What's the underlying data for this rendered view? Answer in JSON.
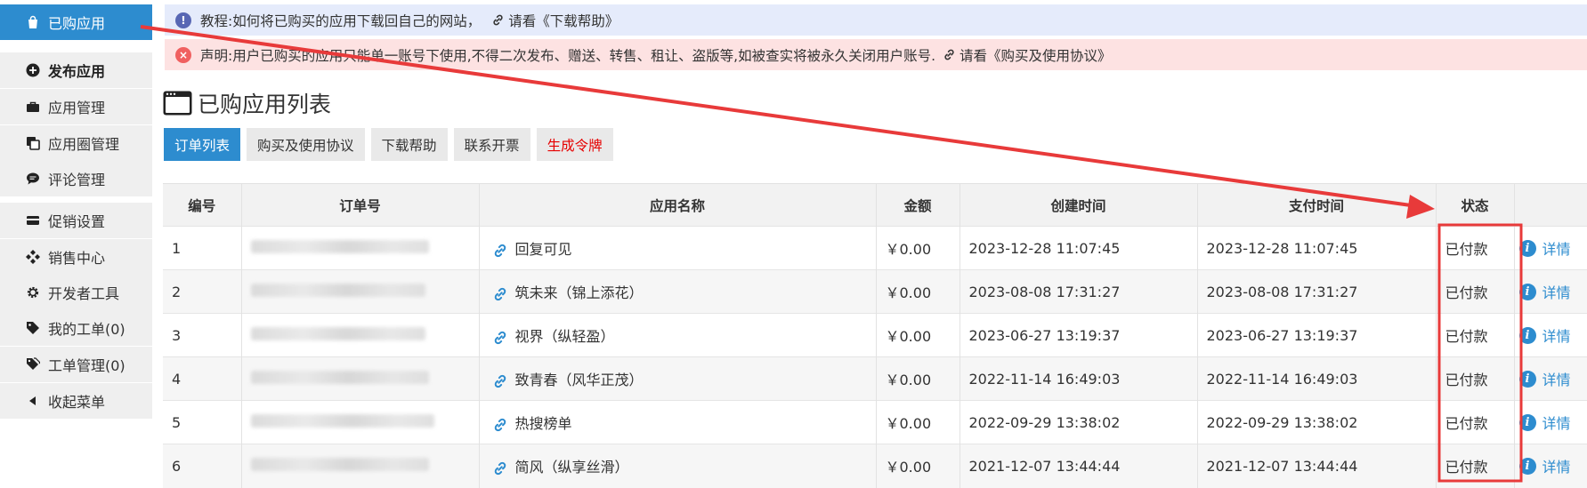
{
  "sidebar": {
    "items": [
      {
        "label": "已购应用",
        "icon": "bag-icon"
      },
      {
        "label": "发布应用",
        "icon": "plus-circle-icon"
      },
      {
        "label": "应用管理",
        "icon": "briefcase-icon"
      },
      {
        "label": "应用圈管理",
        "icon": "copy-icon"
      },
      {
        "label": "评论管理",
        "icon": "comment-icon"
      },
      {
        "label": "促销设置",
        "icon": "card-icon"
      },
      {
        "label": "销售中心",
        "icon": "diamonds-icon"
      },
      {
        "label": "开发者工具",
        "icon": "gear-icon"
      },
      {
        "label": "我的工单(0)",
        "icon": "tag-icon"
      },
      {
        "label": "工单管理(0)",
        "icon": "tags-icon"
      },
      {
        "label": "收起菜单",
        "icon": "caret-left-icon"
      }
    ]
  },
  "alerts": {
    "info": {
      "text": "教程:如何将已购买的应用下载回自己的网站，",
      "link": "请看《下载帮助》"
    },
    "danger": {
      "text": "声明:用户已购买的应用只能单一账号下使用,不得二次发布、赠送、转售、租让、盗版等,如被查实将被永久关闭用户账号.",
      "link": "请看《购买及使用协议》"
    }
  },
  "page": {
    "title": "已购应用列表"
  },
  "tabs": [
    "订单列表",
    "购买及使用协议",
    "下载帮助",
    "联系开票",
    "生成令牌"
  ],
  "table": {
    "headers": [
      "编号",
      "订单号",
      "应用名称",
      "金额",
      "创建时间",
      "支付时间",
      "状态"
    ],
    "rows": [
      {
        "id": "1",
        "app": "回复可见",
        "amount": "￥0.00",
        "created": "2023-12-28 11:07:45",
        "paid": "2023-12-28 11:07:45",
        "status": "已付款",
        "detail": "详情"
      },
      {
        "id": "2",
        "app": "筑未来（锦上添花）",
        "amount": "￥0.00",
        "created": "2023-08-08 17:31:27",
        "paid": "2023-08-08 17:31:27",
        "status": "已付款",
        "detail": "详情"
      },
      {
        "id": "3",
        "app": "视界（纵轻盈）",
        "amount": "￥0.00",
        "created": "2023-06-27 13:19:37",
        "paid": "2023-06-27 13:19:37",
        "status": "已付款",
        "detail": "详情"
      },
      {
        "id": "4",
        "app": "致青春（风华正茂）",
        "amount": "￥0.00",
        "created": "2022-11-14 16:49:03",
        "paid": "2022-11-14 16:49:03",
        "status": "已付款",
        "detail": "详情"
      },
      {
        "id": "5",
        "app": "热搜榜单",
        "amount": "￥0.00",
        "created": "2022-09-29 13:38:02",
        "paid": "2022-09-29 13:38:02",
        "status": "已付款",
        "detail": "详情"
      },
      {
        "id": "6",
        "app": "简风（纵享丝滑）",
        "amount": "￥0.00",
        "created": "2021-12-07 13:44:44",
        "paid": "2021-12-07 13:44:44",
        "status": "已付款",
        "detail": "详情"
      }
    ]
  },
  "colors": {
    "primary": "#2d8ccf",
    "annotation": "#e83a3a",
    "danger_text": "#e60000"
  }
}
